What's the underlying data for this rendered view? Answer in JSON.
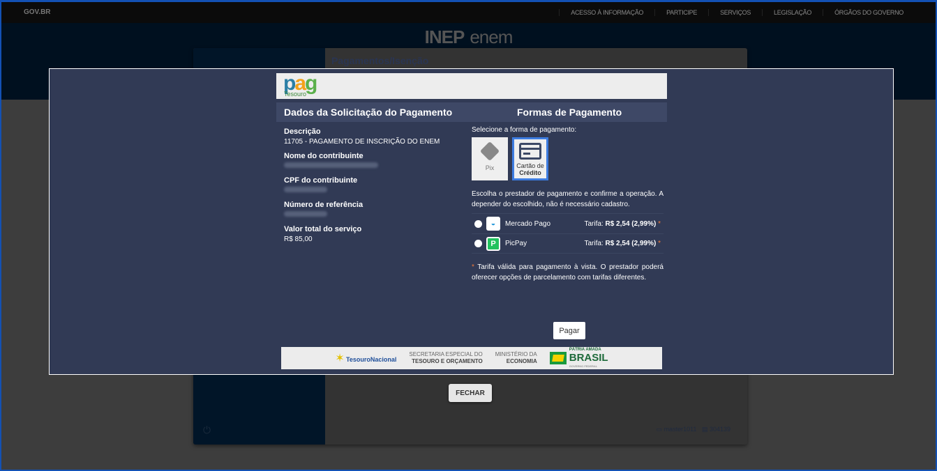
{
  "govbar": {
    "logo": "GOV.BR",
    "links": [
      "ACESSO À INFORMAÇÃO",
      "PARTICIPE",
      "SERVIÇOS",
      "LEGISLAÇÃO",
      "ÓRGÃOS DO GOVERNO"
    ]
  },
  "brand": {
    "inep": "INEP",
    "enem": "enem"
  },
  "page": {
    "title": "Pagamentos/Isenção",
    "fechar": "FECHAR",
    "machine": "master1011",
    "code": "304139"
  },
  "modal": {
    "logo": "pag",
    "logo_sub": "Tesouro",
    "left_header": "Dados da Solicitação do Pagamento",
    "right_header": "Formas de Pagamento",
    "fields": [
      {
        "label": "Descrição",
        "value": "11705 - PAGAMENTO DE INSCRIÇÃO DO ENEM"
      },
      {
        "label": "Nome do contribuinte",
        "value": null
      },
      {
        "label": "CPF do contribuinte",
        "value": null
      },
      {
        "label": "Número de referência",
        "value": null
      },
      {
        "label": "Valor total do serviço",
        "value": "R$  85,00"
      }
    ],
    "select_label": "Selecione a forma de pagamento:",
    "methods": [
      {
        "label": "Pix"
      },
      {
        "label1": "Cartão de",
        "label2": "Crédito",
        "selected": true
      }
    ],
    "instructions": "Escolha o prestador de pagamento e confirme a operação. A depender do escolhido, não é necessário cadastro.",
    "providers": [
      {
        "name": "Mercado Pago",
        "fee_label": "Tarifa:",
        "fee": "R$  2,54 (2,99%)"
      },
      {
        "name": "PicPay",
        "fee_label": "Tarifa:",
        "fee": "R$  2,54 (2,99%)"
      }
    ],
    "asterisk": "*",
    "note": "Tarifa válida para pagamento à vista. O prestador poderá oferecer opções de parcelamento com tarifas diferentes.",
    "pay_button": "Pagar",
    "footer": {
      "tesouro": "TesouroNacional",
      "sec1": "SECRETARIA ESPECIAL DO",
      "sec2": "TESOURO E ORÇAMENTO",
      "min1": "MINISTÉRIO DA",
      "min2": "ECONOMIA",
      "patria": "PÁTRIA AMADA",
      "brasil": "BRASIL",
      "gov": "GOVERNO FEDERAL"
    }
  },
  "colors": {
    "modal_bg": "#313a55",
    "accent": "#3d7ce0",
    "asterisk": "#f07a3a"
  }
}
